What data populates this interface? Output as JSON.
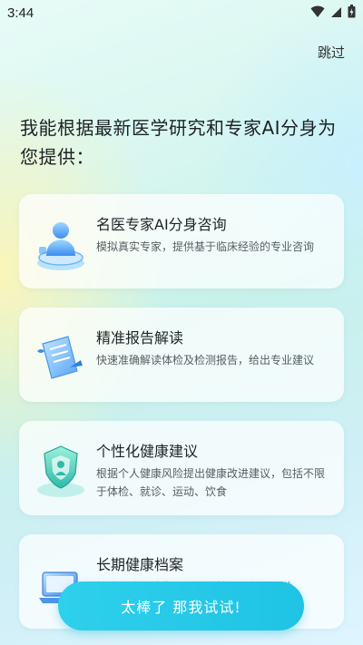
{
  "status_bar": {
    "time": "3:44",
    "icons": [
      "wifi-icon",
      "signal-icon",
      "battery-icon"
    ]
  },
  "header": {
    "skip_label": "跳过"
  },
  "intro": {
    "headline": "我能根据最新医学研究和专家AI分身为您提供："
  },
  "features": [
    {
      "icon": "doctor-avatar-icon",
      "title": "名医专家AI分身咨询",
      "description": "模拟真实专家，提供基于临床经验的专业咨询"
    },
    {
      "icon": "report-document-icon",
      "title": "精准报告解读",
      "description": "快速准确解读体检及检测报告，给出专业建议"
    },
    {
      "icon": "health-shield-icon",
      "title": "个性化健康建议",
      "description": "根据个人健康风险提出健康改进建议，包括不限于体检、就诊、运动、饮食"
    },
    {
      "icon": "laptop-archive-icon",
      "title": "长期健康档案",
      "description": "持续跟踪，建立个人健康档案，长期互动"
    }
  ],
  "cta": {
    "label": "太棒了 那我试试!"
  },
  "colors": {
    "accent": "#22C8E8",
    "background": "#D2F3EE"
  }
}
